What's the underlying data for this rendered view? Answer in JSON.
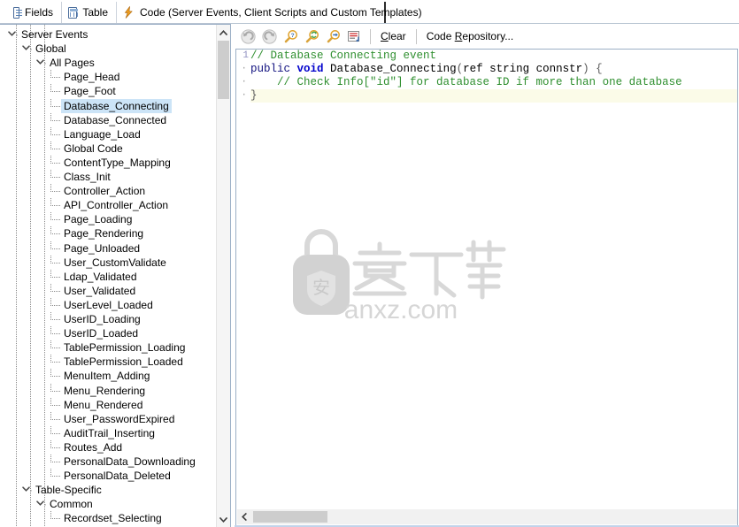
{
  "window": {
    "title": "Code (Server Events, Client Scripts and Custom Templates)"
  },
  "tabs": [
    {
      "id": "fields",
      "label": "Fields",
      "icon": "fields-icon",
      "active": false
    },
    {
      "id": "table",
      "label": "Table",
      "icon": "table-icon",
      "active": false
    },
    {
      "id": "code",
      "label": "Code (Server Events, Client Scripts and Custom Templates)",
      "icon": "lightning-bolt-icon",
      "active": true
    }
  ],
  "tree": {
    "selected": "Database_Connecting",
    "items": [
      {
        "label": "Server Events",
        "depth": 0,
        "expander": "chevron-down-icon"
      },
      {
        "label": "Global",
        "depth": 1,
        "expander": "chevron-down-icon"
      },
      {
        "label": "All Pages",
        "depth": 2,
        "expander": "chevron-down-icon"
      },
      {
        "label": "Page_Head",
        "depth": 3,
        "expander": "leaf"
      },
      {
        "label": "Page_Foot",
        "depth": 3,
        "expander": "leaf"
      },
      {
        "label": "Database_Connecting",
        "depth": 3,
        "expander": "leaf"
      },
      {
        "label": "Database_Connected",
        "depth": 3,
        "expander": "leaf"
      },
      {
        "label": "Language_Load",
        "depth": 3,
        "expander": "leaf"
      },
      {
        "label": "Global Code",
        "depth": 3,
        "expander": "leaf"
      },
      {
        "label": "ContentType_Mapping",
        "depth": 3,
        "expander": "leaf"
      },
      {
        "label": "Class_Init",
        "depth": 3,
        "expander": "leaf"
      },
      {
        "label": "Controller_Action",
        "depth": 3,
        "expander": "leaf"
      },
      {
        "label": "API_Controller_Action",
        "depth": 3,
        "expander": "leaf"
      },
      {
        "label": "Page_Loading",
        "depth": 3,
        "expander": "leaf"
      },
      {
        "label": "Page_Rendering",
        "depth": 3,
        "expander": "leaf"
      },
      {
        "label": "Page_Unloaded",
        "depth": 3,
        "expander": "leaf"
      },
      {
        "label": "User_CustomValidate",
        "depth": 3,
        "expander": "leaf"
      },
      {
        "label": "Ldap_Validated",
        "depth": 3,
        "expander": "leaf"
      },
      {
        "label": "User_Validated",
        "depth": 3,
        "expander": "leaf"
      },
      {
        "label": "UserLevel_Loaded",
        "depth": 3,
        "expander": "leaf"
      },
      {
        "label": "UserID_Loading",
        "depth": 3,
        "expander": "leaf"
      },
      {
        "label": "UserID_Loaded",
        "depth": 3,
        "expander": "leaf"
      },
      {
        "label": "TablePermission_Loading",
        "depth": 3,
        "expander": "leaf"
      },
      {
        "label": "TablePermission_Loaded",
        "depth": 3,
        "expander": "leaf"
      },
      {
        "label": "MenuItem_Adding",
        "depth": 3,
        "expander": "leaf"
      },
      {
        "label": "Menu_Rendering",
        "depth": 3,
        "expander": "leaf"
      },
      {
        "label": "Menu_Rendered",
        "depth": 3,
        "expander": "leaf"
      },
      {
        "label": "User_PasswordExpired",
        "depth": 3,
        "expander": "leaf"
      },
      {
        "label": "AuditTrail_Inserting",
        "depth": 3,
        "expander": "leaf"
      },
      {
        "label": "Routes_Add",
        "depth": 3,
        "expander": "leaf"
      },
      {
        "label": "PersonalData_Downloading",
        "depth": 3,
        "expander": "leaf"
      },
      {
        "label": "PersonalData_Deleted",
        "depth": 3,
        "expander": "leaf"
      },
      {
        "label": "Table-Specific",
        "depth": 1,
        "expander": "chevron-down-icon"
      },
      {
        "label": "Common",
        "depth": 2,
        "expander": "chevron-down-icon"
      },
      {
        "label": "Recordset_Selecting",
        "depth": 3,
        "expander": "leaf"
      }
    ],
    "scrollbar": {
      "up_arrow": "caret-up-icon",
      "down_arrow": "caret-down-icon"
    }
  },
  "toolbar": {
    "buttons": [
      {
        "id": "undo",
        "name": "undo-icon",
        "tooltip": "Undo"
      },
      {
        "id": "redo",
        "name": "redo-icon",
        "tooltip": "Redo"
      },
      {
        "id": "find",
        "name": "find-icon",
        "tooltip": "Find"
      },
      {
        "id": "replace",
        "name": "find-replace-icon",
        "tooltip": "Replace"
      },
      {
        "id": "goto",
        "name": "go-to-line-icon",
        "tooltip": "Go To"
      },
      {
        "id": "format",
        "name": "format-code-icon",
        "tooltip": "Format"
      }
    ],
    "clear_label": "Clear",
    "clear_accel": "C",
    "repository_label": "Code Repository...",
    "repository_accel": "R"
  },
  "editor": {
    "language": "csharp",
    "gutter": [
      "1",
      "·",
      "·",
      "·"
    ],
    "lines": [
      {
        "n": 1,
        "highlight": false,
        "tokens": [
          {
            "t": "// Database Connecting event",
            "c": "cmt"
          }
        ]
      },
      {
        "n": 2,
        "highlight": false,
        "tokens": [
          {
            "t": "public",
            "c": "kw2"
          },
          {
            "t": " ",
            "c": ""
          },
          {
            "t": "void",
            "c": "kw"
          },
          {
            "t": " Database_Connecting",
            "c": ""
          },
          {
            "t": "(",
            "c": "pn"
          },
          {
            "t": "ref string connstr",
            "c": ""
          },
          {
            "t": ")",
            "c": "pn"
          },
          {
            "t": " ",
            "c": ""
          },
          {
            "t": "{",
            "c": "pn"
          }
        ]
      },
      {
        "n": 3,
        "highlight": false,
        "tokens": [
          {
            "t": "    // Check Info[\"id\"] for database ID if more than one database",
            "c": "cmt"
          }
        ]
      },
      {
        "n": 4,
        "highlight": true,
        "tokens": [
          {
            "t": "}",
            "c": "pn"
          }
        ]
      }
    ],
    "hscrollbar": {
      "left_arrow": "caret-left-icon"
    }
  },
  "watermark": {
    "text": "anxz.com",
    "color": "#d6d6d6"
  }
}
